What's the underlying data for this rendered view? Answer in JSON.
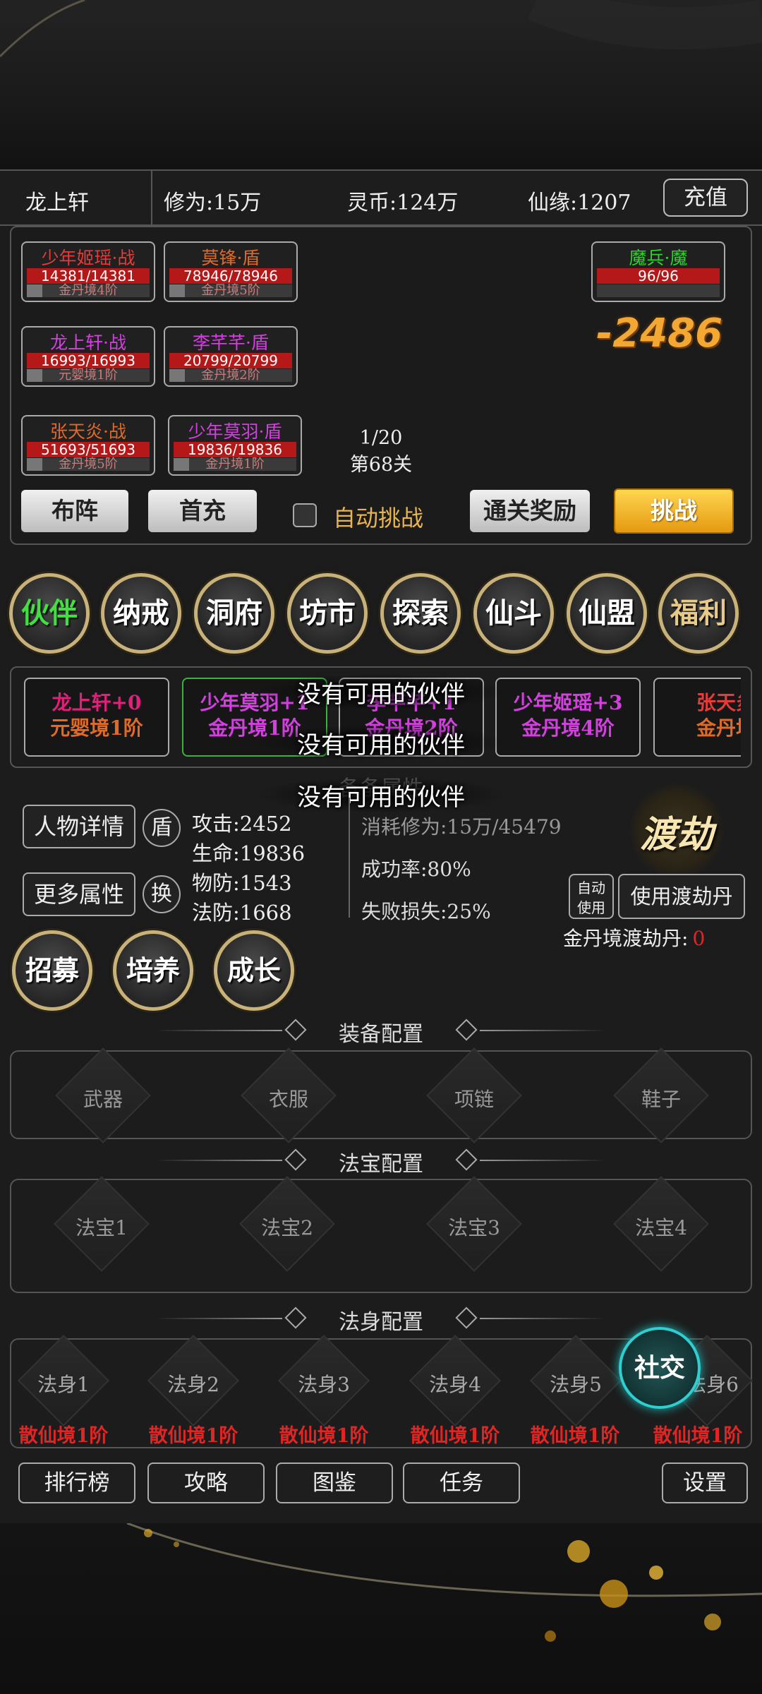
{
  "topbar": {
    "player": "龙上轩",
    "cultivation": "修为:15万",
    "spirit_coin": "灵币:124万",
    "fate": "仙缘:1207",
    "recharge": "充值"
  },
  "battle": {
    "allies": [
      {
        "name": "少年姬瑶·战",
        "hp": "14381/14381",
        "realm": "金丹境4阶"
      },
      {
        "name": "莫锋·盾",
        "hp": "78946/78946",
        "realm": "金丹境5阶"
      },
      {
        "name": "龙上轩·战",
        "hp": "16993/16993",
        "realm": "元婴境1阶"
      },
      {
        "name": "李芊芊·盾",
        "hp": "20799/20799",
        "realm": "金丹境2阶"
      },
      {
        "name": "张天炎·战",
        "hp": "51693/51693",
        "realm": "金丹境5阶"
      },
      {
        "name": "少年莫羽·盾",
        "hp": "19836/19836",
        "realm": "金丹境1阶"
      }
    ],
    "enemy": {
      "name": "魔兵·魔",
      "hp": "96/96"
    },
    "damage": "-2486",
    "wave": "1/20",
    "stage": "第68关",
    "buttons": {
      "formation": "布阵",
      "first_charge": "首充",
      "auto": "自动挑战",
      "clear_reward": "通关奖励",
      "challenge": "挑战"
    }
  },
  "nav": [
    "伙伴",
    "纳戒",
    "洞府",
    "坊市",
    "探索",
    "仙斗",
    "仙盟",
    "福利"
  ],
  "partners": [
    {
      "name": "龙上轩+0",
      "realm": "元婴境1阶"
    },
    {
      "name": "少年莫羽+1",
      "realm": "金丹境1阶"
    },
    {
      "name": "李芊芊+1",
      "realm": "金丹境2阶"
    },
    {
      "name": "少年姬瑶+3",
      "realm": "金丹境4阶"
    },
    {
      "name": "张天炎",
      "realm": "金丹境"
    }
  ],
  "toast": "没有可用的伙伴",
  "faded_title": "备备属性",
  "detail": {
    "btn_detail": "人物详情",
    "badge": "盾",
    "btn_more": "更多属性",
    "swap": "换",
    "attack": "攻击:2452",
    "life": "生命:19836",
    "pdef": "物防:1543",
    "mdef": "法防:1668",
    "cost": "消耗修为:15万/45479",
    "success": "成功率:80%",
    "fail": "失败损失:25%",
    "dujie": "渡劫",
    "auto_use": "自动使用",
    "use_pill": "使用渡劫丹",
    "pill_label": "金丹境渡劫丹:",
    "pill_count": "0"
  },
  "actions": [
    "招募",
    "培养",
    "成长"
  ],
  "equipment": {
    "title": "装备配置",
    "slots": [
      "武器",
      "衣服",
      "项链",
      "鞋子"
    ]
  },
  "treasure": {
    "title": "法宝配置",
    "slots": [
      "法宝1",
      "法宝2",
      "法宝3",
      "法宝4"
    ]
  },
  "body": {
    "title": "法身配置",
    "slots": [
      "法身1",
      "法身2",
      "法身3",
      "法身4",
      "法身5",
      "法身6"
    ],
    "realm": "散仙境1阶"
  },
  "social": "社交",
  "bottom": {
    "rank": "排行榜",
    "guide": "攻略",
    "atlas": "图鉴",
    "task": "任务",
    "settings": "设置"
  },
  "colors": {
    "accent_gold": "#f2a832",
    "hp_red": "#b41818",
    "selected_green": "#3fe040",
    "realm_red": "#e02525",
    "social_cyan": "#2ecfd0"
  }
}
